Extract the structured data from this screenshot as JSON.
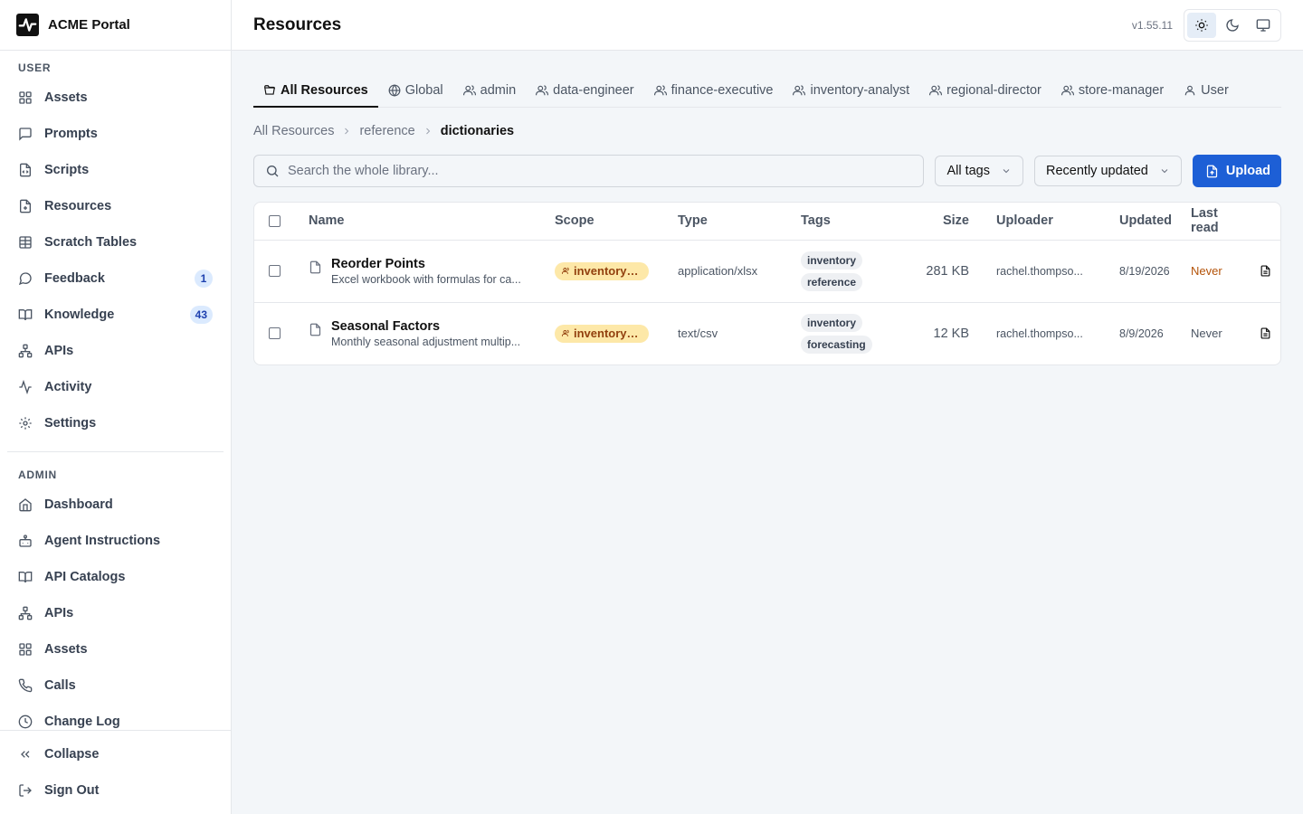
{
  "app": {
    "brand_name": "ACME Portal"
  },
  "sidebar": {
    "user_label": "USER",
    "user_items": [
      {
        "label": "Assets",
        "icon": "grid-icon"
      },
      {
        "label": "Prompts",
        "icon": "message-square-icon"
      },
      {
        "label": "Scripts",
        "icon": "file-code-icon"
      },
      {
        "label": "Resources",
        "icon": "file-plus-icon"
      },
      {
        "label": "Scratch Tables",
        "icon": "table-icon"
      },
      {
        "label": "Feedback",
        "icon": "message-circle-icon",
        "badge": "1"
      },
      {
        "label": "Knowledge",
        "icon": "book-open-icon",
        "badge": "43"
      },
      {
        "label": "APIs",
        "icon": "network-icon"
      },
      {
        "label": "Activity",
        "icon": "activity-icon"
      },
      {
        "label": "Settings",
        "icon": "gear-icon"
      }
    ],
    "admin_label": "ADMIN",
    "admin_items": [
      {
        "label": "Dashboard",
        "icon": "home-icon"
      },
      {
        "label": "Agent Instructions",
        "icon": "bot-icon"
      },
      {
        "label": "API Catalogs",
        "icon": "book-open-icon"
      },
      {
        "label": "APIs",
        "icon": "network-icon"
      },
      {
        "label": "Assets",
        "icon": "grid-icon"
      },
      {
        "label": "Calls",
        "icon": "phone-icon"
      },
      {
        "label": "Change Log",
        "icon": "clock-icon"
      }
    ],
    "footer": {
      "collapse": "Collapse",
      "sign_out": "Sign Out"
    }
  },
  "header": {
    "title": "Resources",
    "version": "v1.55.11"
  },
  "tabs": [
    {
      "label": "All Resources",
      "icon": "folder-open-icon",
      "active": true
    },
    {
      "label": "Global",
      "icon": "globe-icon"
    },
    {
      "label": "admin",
      "icon": "users-icon"
    },
    {
      "label": "data-engineer",
      "icon": "users-icon"
    },
    {
      "label": "finance-executive",
      "icon": "users-icon"
    },
    {
      "label": "inventory-analyst",
      "icon": "users-icon"
    },
    {
      "label": "regional-director",
      "icon": "users-icon"
    },
    {
      "label": "store-manager",
      "icon": "users-icon"
    },
    {
      "label": "User",
      "icon": "user-icon"
    }
  ],
  "breadcrumb": {
    "root": "All Resources",
    "middle": "reference",
    "current": "dictionaries"
  },
  "toolbar": {
    "search_placeholder": "Search the whole library...",
    "tags_filter": "All tags",
    "sort": "Recently updated",
    "upload": "Upload"
  },
  "table": {
    "headers": {
      "name": "Name",
      "scope": "Scope",
      "type": "Type",
      "tags": "Tags",
      "size": "Size",
      "uploader": "Uploader",
      "updated": "Updated",
      "last_read": "Last read"
    },
    "rows": [
      {
        "name": "Reorder Points",
        "description": "Excel workbook with formulas for ca...",
        "scope": "inventory-a...",
        "type": "application/xlsx",
        "tags": [
          "inventory",
          "reference"
        ],
        "size": "281 KB",
        "uploader": "rachel.thompso...",
        "updated": "8/19/2026",
        "last_read": "Never",
        "last_read_warn": true
      },
      {
        "name": "Seasonal Factors",
        "description": "Monthly seasonal adjustment multip...",
        "scope": "inventory-a...",
        "type": "text/csv",
        "tags": [
          "inventory",
          "forecasting"
        ],
        "size": "12 KB",
        "uploader": "rachel.thompso...",
        "updated": "8/9/2026",
        "last_read": "Never",
        "last_read_warn": false
      }
    ]
  },
  "colors": {
    "primary": "#1d5fd6",
    "scope_badge_bg": "#fde8a8",
    "warn_text": "#b45309",
    "badge_bg": "#dbeafe"
  }
}
